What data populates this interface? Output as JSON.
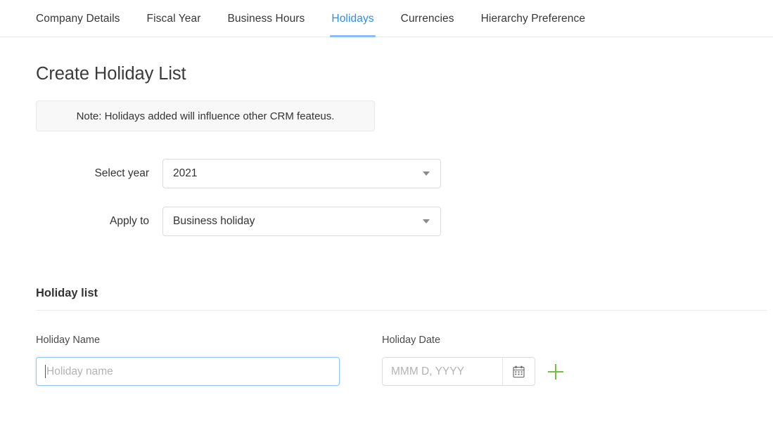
{
  "tabs": [
    {
      "label": "Company Details",
      "active": false
    },
    {
      "label": "Fiscal Year",
      "active": false
    },
    {
      "label": "Business Hours",
      "active": false
    },
    {
      "label": "Holidays",
      "active": true
    },
    {
      "label": "Currencies",
      "active": false
    },
    {
      "label": "Hierarchy Preference",
      "active": false
    }
  ],
  "page": {
    "title": "Create Holiday List",
    "note": "Note: Holidays added will influence other CRM feateus."
  },
  "form": {
    "year": {
      "label": "Select year",
      "value": "2021"
    },
    "apply_to": {
      "label": "Apply to",
      "value": "Business holiday"
    }
  },
  "holiday_list": {
    "section_title": "Holiday list",
    "columns": {
      "name": "Holiday Name",
      "date": "Holiday Date"
    },
    "row": {
      "name_placeholder": "Holiday name",
      "date_placeholder": "MMM D, YYYY",
      "calendar_icon": "calendar-icon",
      "add_icon": "plus-icon"
    }
  },
  "colors": {
    "accent_blue": "#2d8cf0",
    "underline_blue": "#8cbcf7",
    "focus_border": "#91c6f5",
    "add_green": "#74c044",
    "note_bg": "#f8f8f8"
  }
}
